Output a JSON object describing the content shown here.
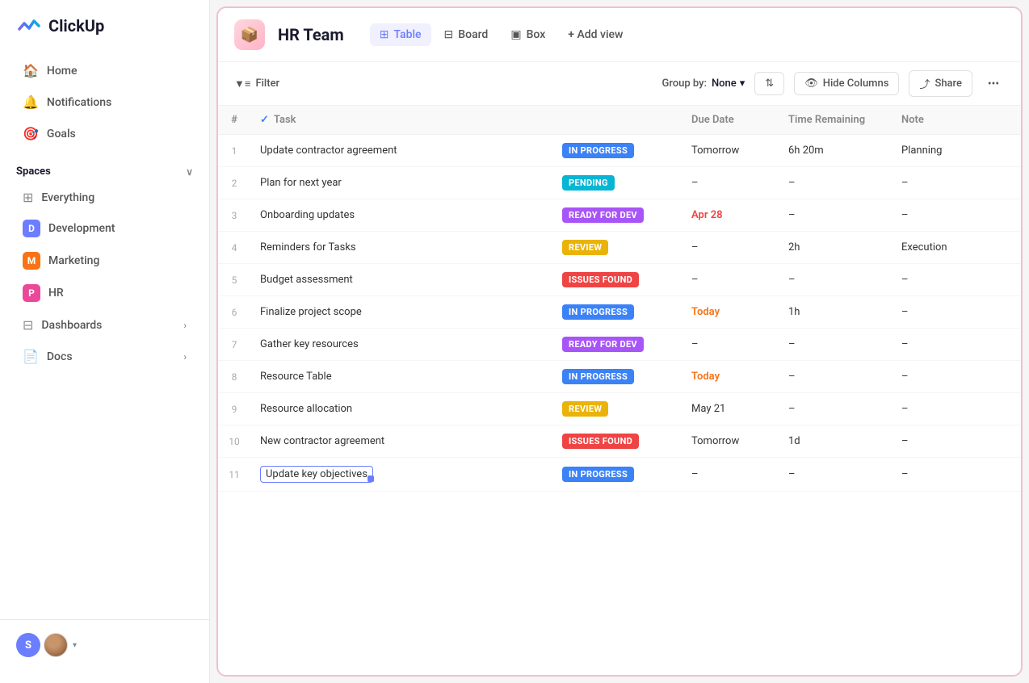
{
  "logo": {
    "text": "ClickUp"
  },
  "sidebar": {
    "nav": [
      {
        "id": "home",
        "label": "Home",
        "icon": "🏠"
      },
      {
        "id": "notifications",
        "label": "Notifications",
        "icon": "🔔"
      },
      {
        "id": "goals",
        "label": "Goals",
        "icon": "🎯"
      }
    ],
    "spaces_label": "Spaces",
    "everything_label": "Everything",
    "spaces": [
      {
        "id": "development",
        "label": "Development",
        "badge": "D",
        "badge_class": "badge-d"
      },
      {
        "id": "marketing",
        "label": "Marketing",
        "badge": "M",
        "badge_class": "badge-m"
      },
      {
        "id": "hr",
        "label": "HR",
        "badge": "P",
        "badge_class": "badge-p"
      }
    ],
    "dashboards_label": "Dashboards",
    "docs_label": "Docs"
  },
  "header": {
    "space_icon": "📦",
    "title": "HR Team",
    "views": [
      {
        "id": "table",
        "label": "Table",
        "active": true
      },
      {
        "id": "board",
        "label": "Board",
        "active": false
      },
      {
        "id": "box",
        "label": "Box",
        "active": false
      }
    ],
    "add_view_label": "+ Add view"
  },
  "toolbar": {
    "filter_label": "Filter",
    "group_by_label": "Group by:",
    "group_by_value": "None",
    "hide_columns_label": "Hide Columns",
    "share_label": "Share"
  },
  "table": {
    "columns": [
      {
        "id": "num",
        "label": "#"
      },
      {
        "id": "task",
        "label": "Task"
      },
      {
        "id": "status",
        "label": ""
      },
      {
        "id": "due",
        "label": "Due Date"
      },
      {
        "id": "time",
        "label": "Time Remaining"
      },
      {
        "id": "note",
        "label": "Note"
      }
    ],
    "rows": [
      {
        "num": 1,
        "task": "Update contractor agreement",
        "status": "IN PROGRESS",
        "status_class": "status-in-progress",
        "due": "Tomorrow",
        "due_class": "due-normal",
        "time": "6h 20m",
        "note": "Planning"
      },
      {
        "num": 2,
        "task": "Plan for next year",
        "status": "PENDING",
        "status_class": "status-pending",
        "due": "–",
        "due_class": "due-normal",
        "time": "–",
        "note": "–"
      },
      {
        "num": 3,
        "task": "Onboarding updates",
        "status": "READY FOR DEV",
        "status_class": "status-ready-for-dev",
        "due": "Apr 28",
        "due_class": "due-apr",
        "time": "–",
        "note": "–"
      },
      {
        "num": 4,
        "task": "Reminders for Tasks",
        "status": "REVIEW",
        "status_class": "status-review",
        "due": "–",
        "due_class": "due-normal",
        "time": "2h",
        "note": "Execution"
      },
      {
        "num": 5,
        "task": "Budget assessment",
        "status": "ISSUES FOUND",
        "status_class": "status-issues-found",
        "due": "–",
        "due_class": "due-normal",
        "time": "–",
        "note": "–"
      },
      {
        "num": 6,
        "task": "Finalize project scope",
        "status": "IN PROGRESS",
        "status_class": "status-in-progress",
        "due": "Today",
        "due_class": "due-today",
        "time": "1h",
        "note": "–"
      },
      {
        "num": 7,
        "task": "Gather key resources",
        "status": "READY FOR DEV",
        "status_class": "status-ready-for-dev",
        "due": "–",
        "due_class": "due-normal",
        "time": "–",
        "note": "–"
      },
      {
        "num": 8,
        "task": "Resource Table",
        "status": "IN PROGRESS",
        "status_class": "status-in-progress",
        "due": "Today",
        "due_class": "due-today",
        "time": "–",
        "note": "–"
      },
      {
        "num": 9,
        "task": "Resource allocation",
        "status": "REVIEW",
        "status_class": "status-review",
        "due": "May 21",
        "due_class": "due-normal",
        "time": "–",
        "note": "–"
      },
      {
        "num": 10,
        "task": "New contractor agreement",
        "status": "ISSUES FOUND",
        "status_class": "status-issues-found",
        "due": "Tomorrow",
        "due_class": "due-normal",
        "time": "1d",
        "note": "–"
      },
      {
        "num": 11,
        "task": "Update key objectives",
        "status": "IN PROGRESS",
        "status_class": "status-in-progress",
        "due": "–",
        "due_class": "due-normal",
        "time": "–",
        "note": "–",
        "selected": true
      }
    ]
  }
}
